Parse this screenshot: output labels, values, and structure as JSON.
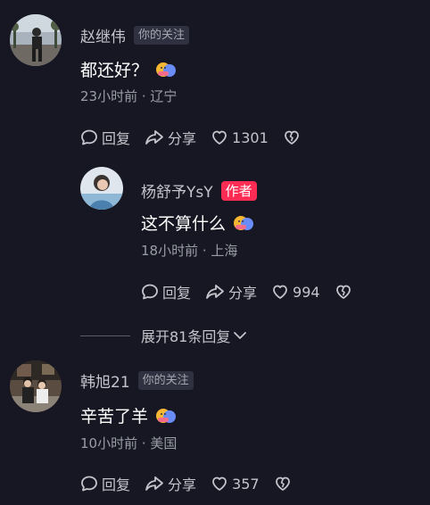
{
  "comments": [
    {
      "username": "赵继伟",
      "badge": "你的关注",
      "text": "都还好？",
      "time_location": "23小时前 · 辽宁",
      "reply_label": "回复",
      "share_label": "分享",
      "likes": "1301"
    },
    {
      "username": "杨舒予YsY",
      "badge": "作者",
      "text": "这不算什么",
      "time_location": "18小时前 · 上海",
      "reply_label": "回复",
      "share_label": "分享",
      "likes": "994"
    },
    {
      "username": "韩旭21",
      "badge": "你的关注",
      "text": "辛苦了羊",
      "time_location": "10小时前 · 美国",
      "reply_label": "回复",
      "share_label": "分享",
      "likes": "357"
    }
  ],
  "expand_replies": "展开81条回复",
  "icons": {
    "reply": "comment-bubble-icon",
    "share": "share-arrow-icon",
    "like": "heart-icon",
    "dislike": "broken-heart-icon",
    "expand": "chevron-down-icon",
    "emoji": "hug-emoji"
  },
  "colors": {
    "background": "#161722",
    "author_badge": "#fe2c55",
    "follow_badge": "#2f3040"
  }
}
